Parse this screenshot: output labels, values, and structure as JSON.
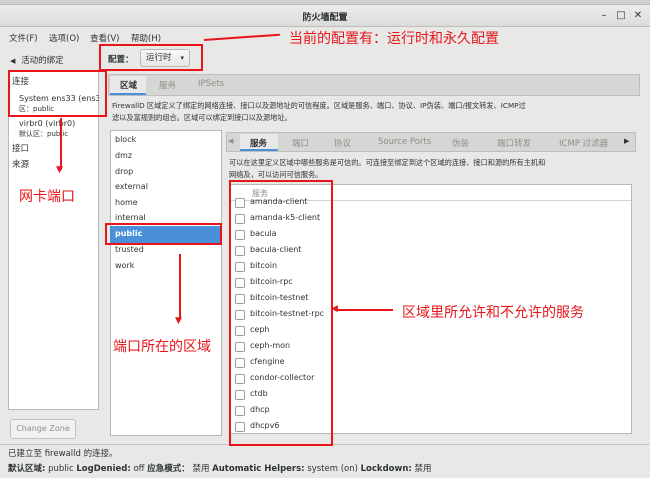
{
  "window": {
    "title": "防火墙配置",
    "minimize_glyph": "–",
    "maximize_glyph": "□",
    "close_glyph": "✕"
  },
  "menu": [
    {
      "label": "文件(F)"
    },
    {
      "label": "选项(O)"
    },
    {
      "label": "查看(V)"
    },
    {
      "label": "帮助(H)"
    }
  ],
  "left": {
    "header": "活动的绑定",
    "sections": {
      "connections": "连接",
      "interfaces": "接口",
      "sources": "来源"
    },
    "connection_name": "System ens33 (ens33)",
    "connection_zone": "区：public",
    "interface_name": "virbr0 (virbr0)",
    "interface_zone": "默认区：public",
    "change_zone_button": "Change Zone"
  },
  "config": {
    "label": "配置：",
    "value": "运行时"
  },
  "main_tabs": [
    "区域",
    "服务",
    "IPSets"
  ],
  "zone_description": [
    "FirewallD 区域定义了绑定的网络连接、接口以及源地址的可信程度。区域是服务、端口、协议、IP伪装、端口/报文转发、ICMP过",
    "滤以及富规则的组合。区域可以绑定到接口以及源地址。"
  ],
  "zones": [
    "block",
    "dmz",
    "drop",
    "external",
    "home",
    "internal",
    "public",
    "trusted",
    "work"
  ],
  "selected_zone": "public",
  "zone_tabs": [
    "服务",
    "端口",
    "协议",
    "Source Ports",
    "伪装",
    "端口转发",
    "ICMP 过滤器"
  ],
  "service_description": [
    "可以在这里定义区域中哪些服务是可信的。可连接至绑定到这个区域的连接、接口和源的所有主机和",
    "网络及，可以访问可信服务。"
  ],
  "service_table": {
    "header": "服务",
    "rows": [
      "amanda-client",
      "amanda-k5-client",
      "bacula",
      "bacula-client",
      "bitcoin",
      "bitcoin-rpc",
      "bitcoin-testnet",
      "bitcoin-testnet-rpc",
      "ceph",
      "ceph-mon",
      "cfengine",
      "condor-collector",
      "ctdb",
      "dhcp",
      "dhcpv6"
    ]
  },
  "status": {
    "line1": "已建立至  firewalld 的连接。",
    "default_zone_label": "默认区域:",
    "default_zone": "public",
    "log_denied_label": "LogDenied:",
    "log_denied": "off",
    "panic_label": "应急模式：",
    "panic": "禁用",
    "helpers_label": "Automatic Helpers:",
    "helpers": "system (on)",
    "lockdown_label": "Lockdown:",
    "lockdown": "禁用"
  },
  "annotations": {
    "config_note": "当前的配置有：运行时和永久配置",
    "nic_note": "网卡端口",
    "zone_note": "端口所在的区域",
    "service_note": "区域里所允许和不允许的服务"
  },
  "colors": {
    "annotation_red": "#e8161b",
    "selection_blue": "#4a90d9"
  }
}
